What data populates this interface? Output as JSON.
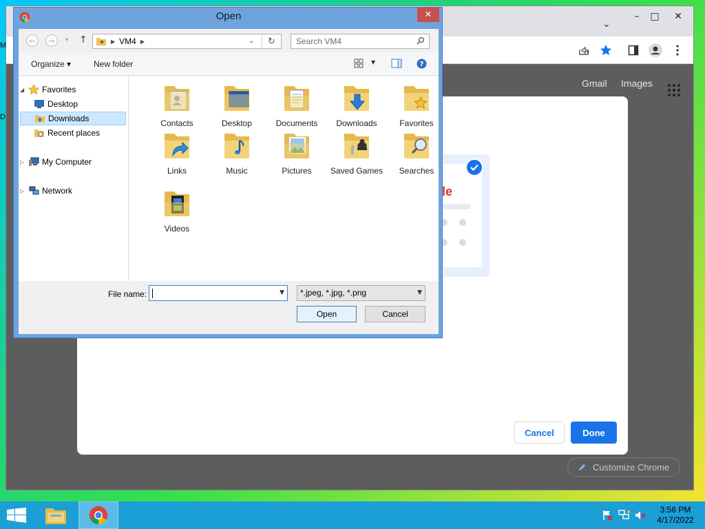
{
  "chrome": {
    "gmail": "Gmail",
    "images": "Images",
    "cancel": "Cancel",
    "done": "Done",
    "customize": "Customize Chrome",
    "card_letter": "le"
  },
  "dialog": {
    "title": "Open",
    "address": {
      "location": "VM4"
    },
    "search": {
      "placeholder": "Search VM4"
    },
    "toolbar": {
      "organize": "Organize ▾",
      "new_folder": "New folder"
    },
    "tree": {
      "favorites": "Favorites",
      "desktop": "Desktop",
      "downloads": "Downloads",
      "recent": "Recent places",
      "computer": "My Computer",
      "network": "Network"
    },
    "folders": [
      {
        "label": "Contacts"
      },
      {
        "label": "Desktop"
      },
      {
        "label": "Documents"
      },
      {
        "label": "Downloads"
      },
      {
        "label": "Favorites"
      },
      {
        "label": "Links"
      },
      {
        "label": "Music"
      },
      {
        "label": "Pictures"
      },
      {
        "label": "Saved Games"
      },
      {
        "label": "Searches"
      },
      {
        "label": "Videos"
      }
    ],
    "file_name_label": "File name:",
    "file_name_value": "",
    "filter": "*.jpeg, *.jpg, *.png",
    "open": "Open",
    "cancel": "Cancel"
  },
  "taskbar": {
    "time": "3:56 PM",
    "date": "4/17/2022"
  },
  "desktop_edge": {
    "m": "M",
    "d": "D"
  },
  "colors": {
    "chrome_blue": "#1a73e8",
    "taskbar": "#1c9ed6",
    "dialog_frame": "#6ea4de",
    "close_red": "#c74f4f"
  }
}
